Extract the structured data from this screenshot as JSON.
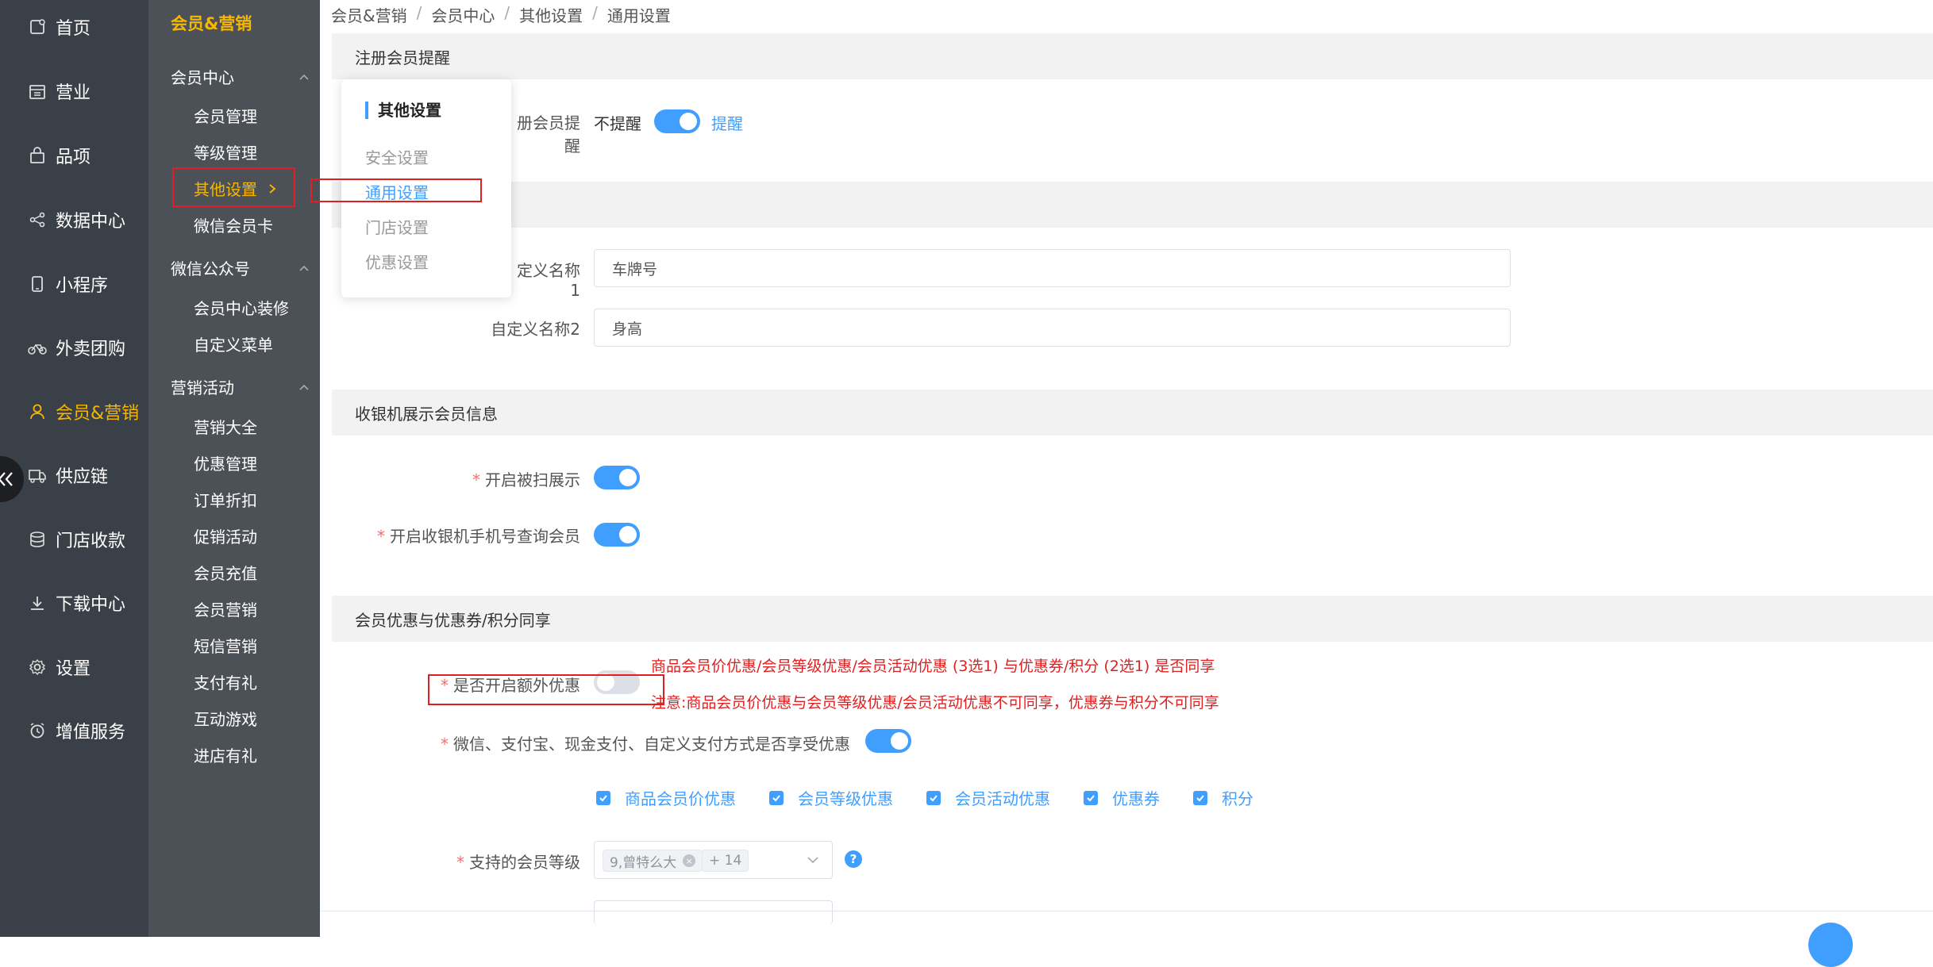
{
  "colors": {
    "nav_bg": "#3a4047",
    "subnav_bg": "#4b5157",
    "accent": "#f7b600",
    "primary": "#409eff",
    "warning_red": "#e02020"
  },
  "left_nav": [
    {
      "label": "首页",
      "icon": "home-icon"
    },
    {
      "label": "营业",
      "icon": "calendar-icon"
    },
    {
      "label": "品项",
      "icon": "bag-icon"
    },
    {
      "label": "数据中心",
      "icon": "share-icon"
    },
    {
      "label": "小程序",
      "icon": "phone-icon"
    },
    {
      "label": "外卖团购",
      "icon": "bike-icon"
    },
    {
      "label": "会员&营销",
      "icon": "user-icon",
      "active": true
    },
    {
      "label": "供应链",
      "icon": "truck-icon"
    },
    {
      "label": "门店收款",
      "icon": "coins-icon"
    },
    {
      "label": "下载中心",
      "icon": "download-icon"
    },
    {
      "label": "设置",
      "icon": "gear-icon"
    },
    {
      "label": "增值服务",
      "icon": "alarm-icon"
    }
  ],
  "sub_nav": {
    "title": "会员&营销",
    "groups": [
      {
        "label": "会员中心",
        "items": [
          "会员管理",
          "等级管理",
          "其他设置",
          "微信会员卡"
        ]
      },
      {
        "label": "微信公众号",
        "items": [
          "会员中心装修",
          "自定义菜单"
        ]
      },
      {
        "label": "营销活动",
        "items": [
          "营销大全",
          "优惠管理",
          "订单折扣",
          "促销活动",
          "会员充值",
          "会员营销",
          "短信营销",
          "支付有礼",
          "互动游戏",
          "进店有礼"
        ]
      }
    ]
  },
  "breadcrumb": [
    "会员&营销",
    "会员中心",
    "其他设置",
    "通用设置"
  ],
  "popup": {
    "title": "其他设置",
    "items": [
      "安全设置",
      "通用设置",
      "门店设置",
      "优惠设置"
    ]
  },
  "sections": {
    "register": {
      "title": "注册会员提醒",
      "label": "册会员提醒",
      "off_text": "不提醒",
      "on_text": "提醒"
    },
    "custom": {
      "label1": "定义名称1",
      "value1": "车牌号",
      "label2": "自定义名称2",
      "value2": "身高"
    },
    "cashier": {
      "title": "收银机展示会员信息",
      "scan_label": "开启被扫展示",
      "phone_label": "开启收银机手机号查询会员"
    },
    "discount": {
      "title": "会员优惠与优惠券/积分同享",
      "extra_label": "是否开启额外优惠",
      "note1": "商品会员价优惠/会员等级优惠/会员活动优惠 (3选1) 与优惠券/积分 (2选1) 是否同享",
      "note2": "注意:商品会员价优惠与会员等级优惠/会员活动优惠不可同享，优惠券与积分不可同享",
      "payment_label": "微信、支付宝、现金支付、自定义支付方式是否享受优惠",
      "checkboxes": [
        "商品会员价优惠",
        "会员等级优惠",
        "会员活动优惠",
        "优惠券",
        "积分"
      ],
      "level_label": "支持的会员等级",
      "level_tag": "9,曾特么大",
      "level_more": "+ 14",
      "help": "?"
    }
  }
}
